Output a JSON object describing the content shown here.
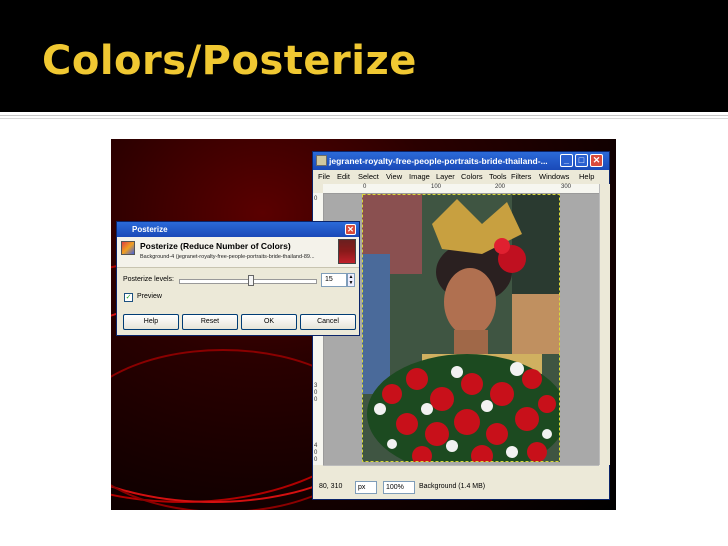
{
  "slide": {
    "title": "Colors/Posterize"
  },
  "gimp_window": {
    "title": "jegranet-royalty-free-people-portraits-bride-thailand-...",
    "menu": [
      "File",
      "Edit",
      "Select",
      "View",
      "Image",
      "Layer",
      "Colors",
      "Tools",
      "Filters",
      "Windows",
      "Help"
    ],
    "ruler_top_labels": [
      "0",
      "100",
      "200",
      "300"
    ],
    "ruler_left_labels": [
      "0",
      "1",
      "0",
      "0",
      "2",
      "0",
      "0",
      "3",
      "0",
      "0",
      "4",
      "0",
      "0"
    ],
    "status": {
      "coords": "80, 310",
      "unit": "px",
      "zoom": "100%",
      "layer_info": "Background (1.4 MB)"
    },
    "controls": {
      "minimize": "_",
      "maximize": "□",
      "close": "✕"
    }
  },
  "posterize_dialog": {
    "title": "Posterize",
    "close": "✕",
    "header_title": "Posterize (Reduce Number of Colors)",
    "header_subtitle": "Background-4 (jegranet-royalty-free-people-portraits-bride-thailand-89...",
    "levels_label": "Posterize levels:",
    "levels_value": "15",
    "levels_slider_fraction": 0.52,
    "preview_label": "Preview",
    "preview_checked": true,
    "buttons": {
      "help": "Help",
      "reset": "Reset",
      "ok": "OK",
      "cancel": "Cancel"
    }
  },
  "colors": {
    "title_text": "#f0c832",
    "title_bg": "#000000",
    "window_titlebar": "#2b6ad8",
    "dialog_bg": "#ece9d8"
  }
}
